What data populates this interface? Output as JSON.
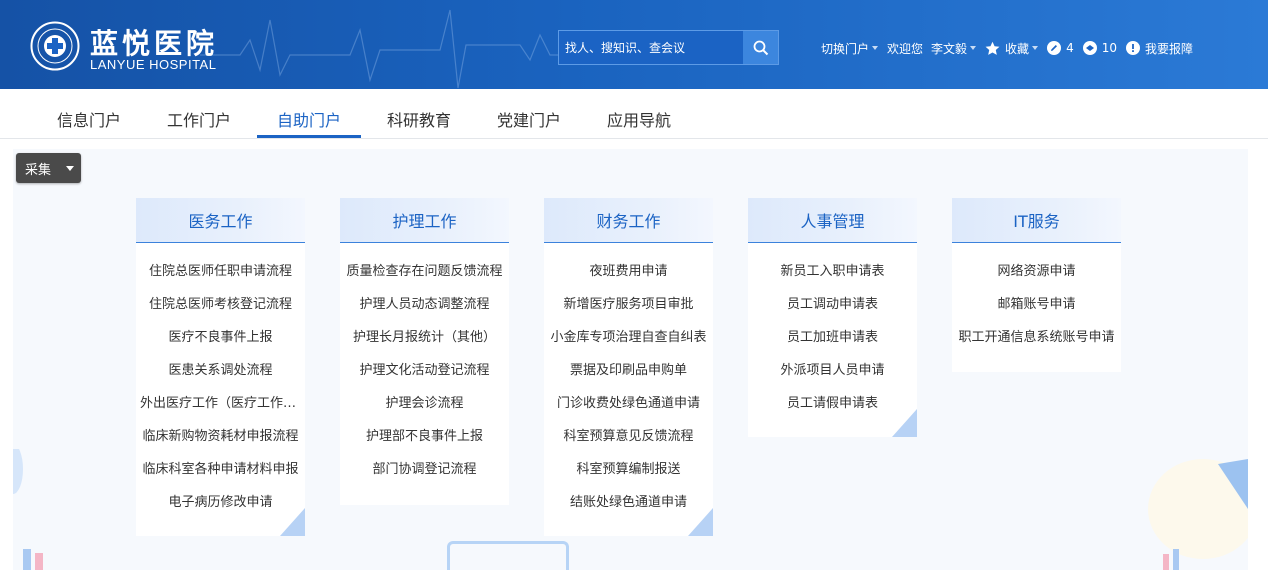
{
  "brand": {
    "name_cn": "蓝悦医院",
    "name_en": "LANYUE HOSPITAL"
  },
  "search": {
    "placeholder": "找人、搜知识、查会议"
  },
  "topbar": {
    "switch_portal": "切换门户",
    "welcome": "欢迎您",
    "user": "李文毅",
    "favorites": "收藏",
    "edit_count": "4",
    "message_count": "10",
    "report": "我要报障"
  },
  "nav": {
    "tabs": [
      "信息门户",
      "工作门户",
      "自助门户",
      "科研教育",
      "党建门户",
      "应用导航"
    ],
    "active_index": 2
  },
  "toolbar": {
    "collect_label": "采集"
  },
  "cards": [
    {
      "title": "医务工作",
      "items": [
        "住院总医师任职申请流程",
        "住院总医师考核登记流程",
        "医疗不良事件上报",
        "医患关系调处流程",
        "外出医疗工作（医疗工作调整）",
        "临床新购物资耗材申报流程",
        "临床科室各种申请材料申报",
        "电子病历修改申请"
      ]
    },
    {
      "title": "护理工作",
      "items": [
        "质量检查存在问题反馈流程",
        "护理人员动态调整流程",
        "护理长月报统计（其他）",
        "护理文化活动登记流程",
        "护理会诊流程",
        "护理部不良事件上报",
        "部门协调登记流程"
      ]
    },
    {
      "title": "财务工作",
      "items": [
        "夜班费用申请",
        "新增医疗服务项目审批",
        "小金库专项治理自查自纠表",
        "票据及印刷品申购单",
        "门诊收费处绿色通道申请",
        "科室预算意见反馈流程",
        "科室预算编制报送",
        "结账处绿色通道申请"
      ]
    },
    {
      "title": "人事管理",
      "items": [
        "新员工入职申请表",
        "员工调动申请表",
        "员工加班申请表",
        "外派项目人员申请",
        "员工请假申请表"
      ]
    },
    {
      "title": "IT服务",
      "items": [
        "网络资源申请",
        "邮箱账号申请",
        "职工开通信息系统账号申请"
      ]
    }
  ],
  "colors": {
    "header_blue": "#1b63c4",
    "accent": "#1b63c4",
    "card_corner": "#b7d2f5"
  }
}
